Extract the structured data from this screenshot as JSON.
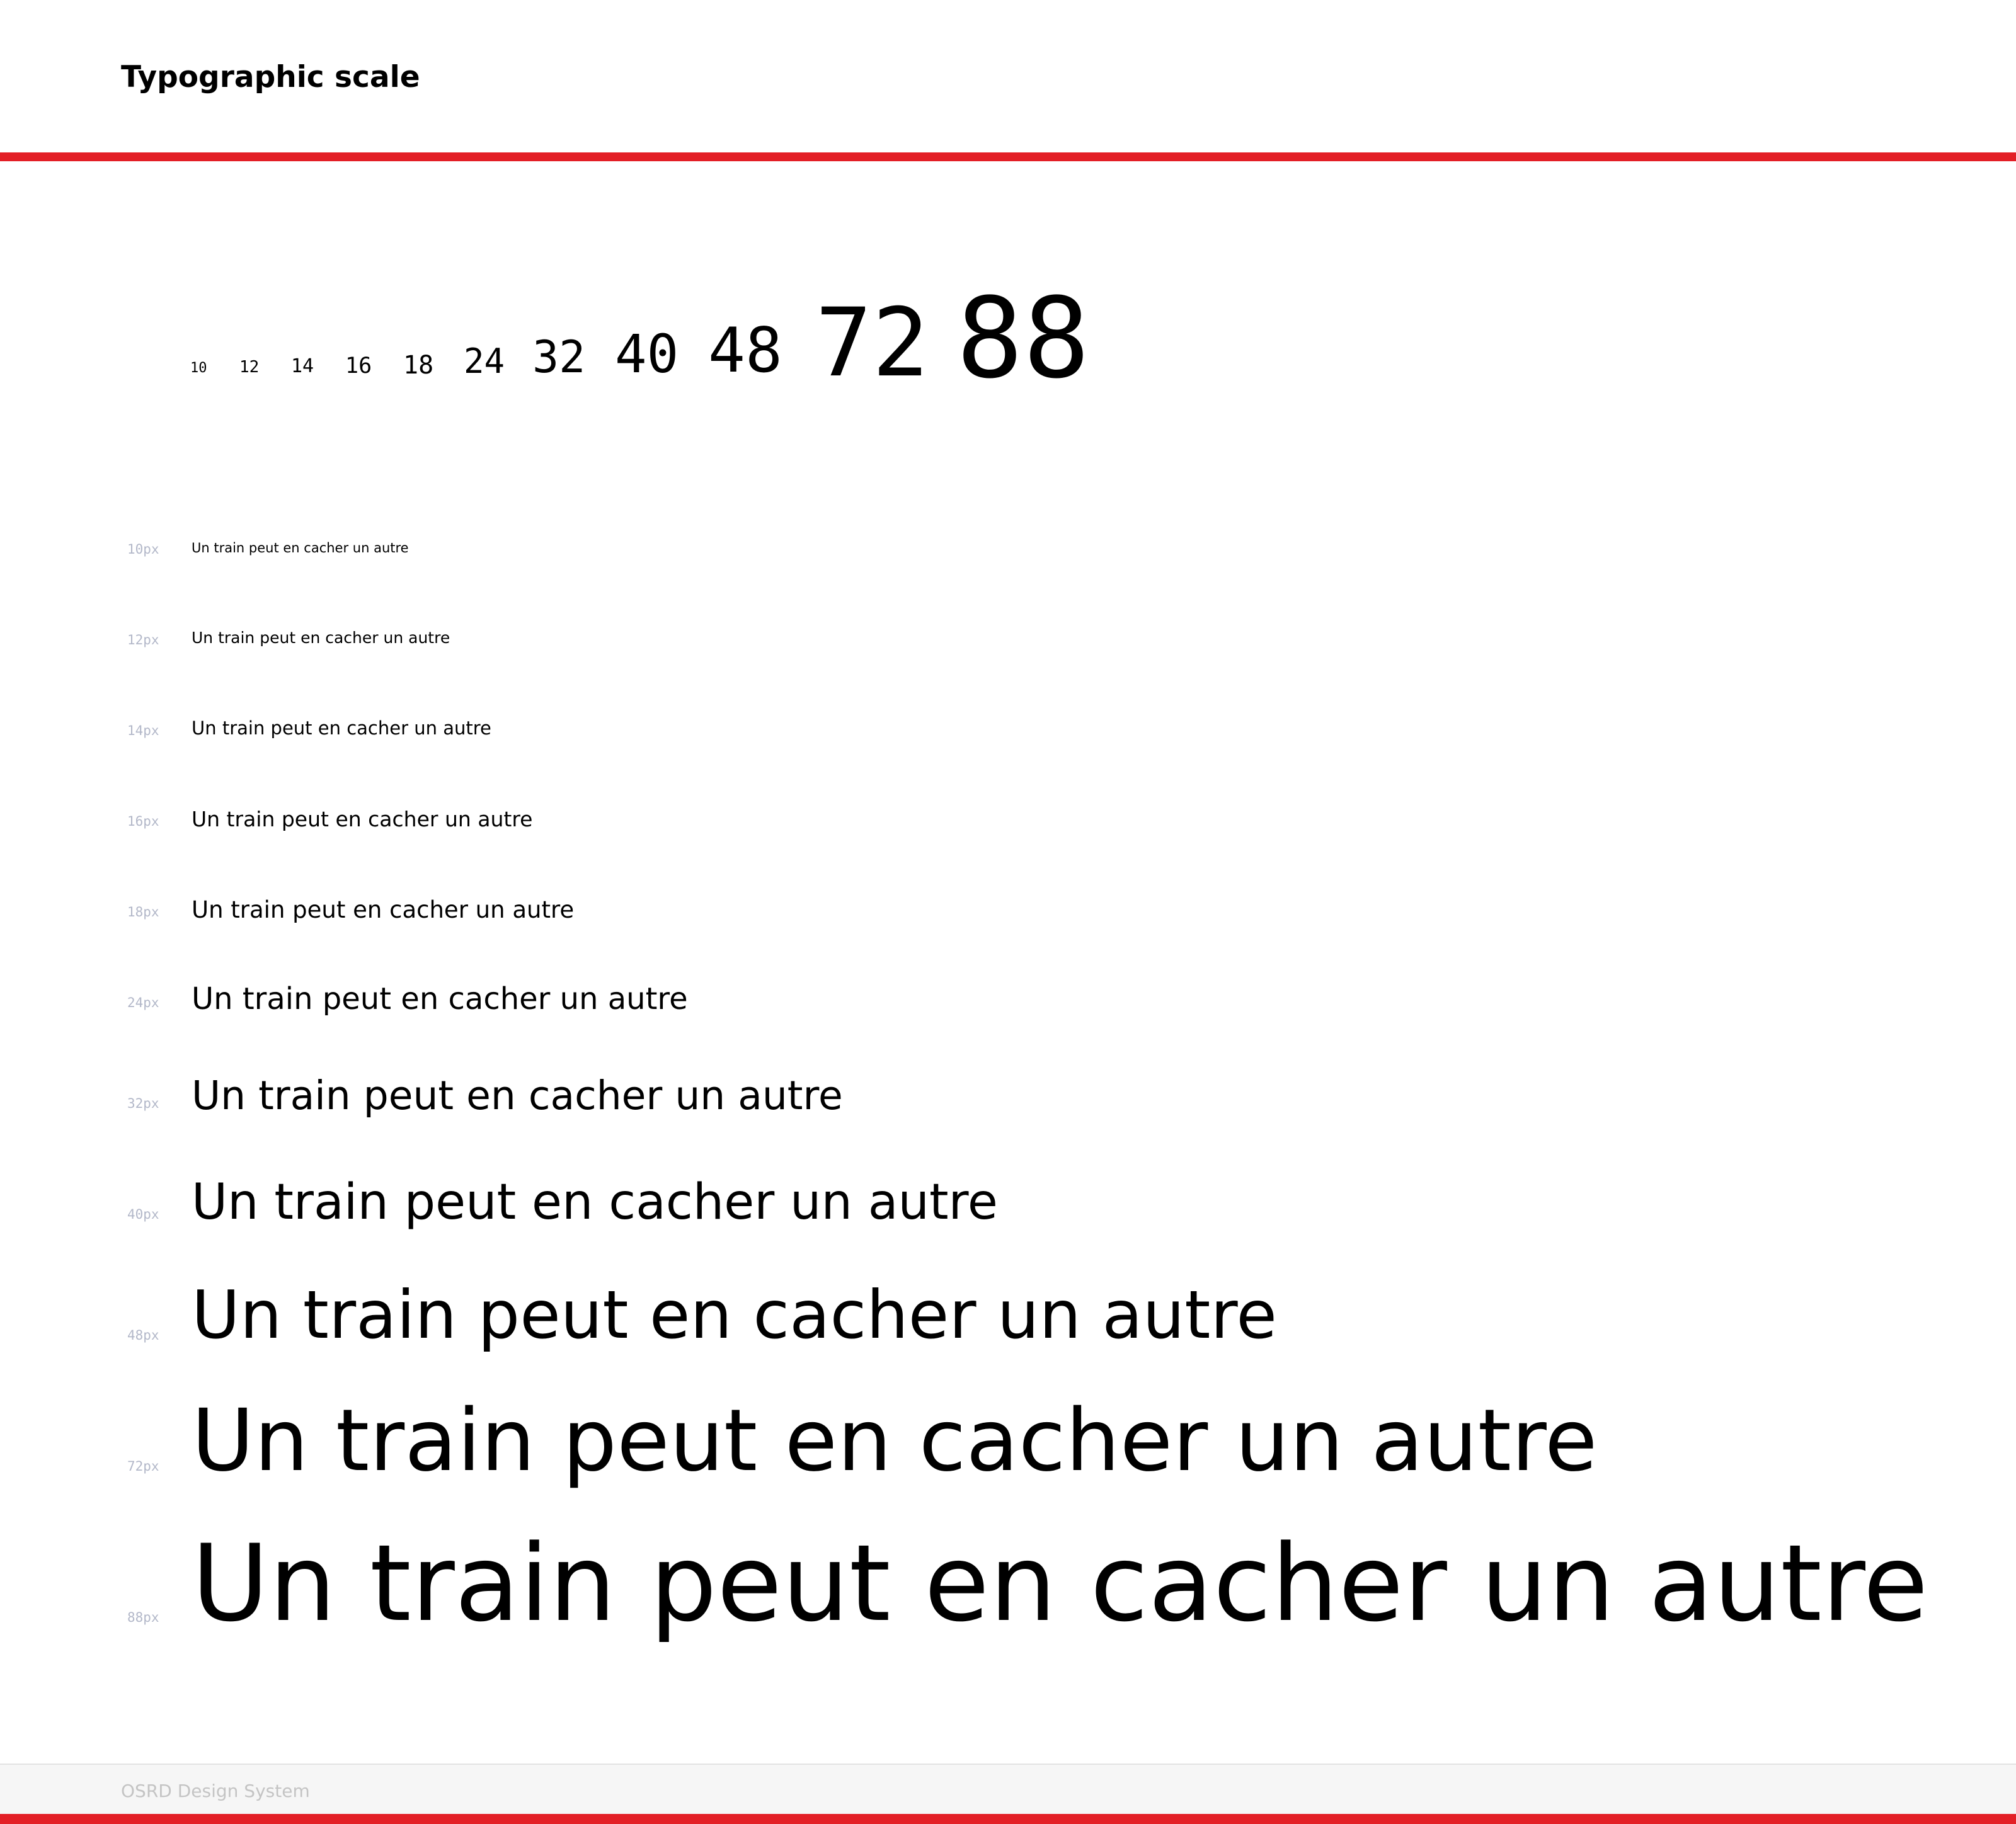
{
  "header": {
    "title": "Typographic scale"
  },
  "scale": {
    "sizes": [
      "10",
      "12",
      "14",
      "16",
      "18",
      "24",
      "32",
      "40",
      "48",
      "72",
      "88"
    ]
  },
  "samples": [
    {
      "label": "10px",
      "text": "Un train peut en cacher un autre"
    },
    {
      "label": "12px",
      "text": "Un train peut en cacher un autre"
    },
    {
      "label": "14px",
      "text": "Un train peut en cacher un autre"
    },
    {
      "label": "16px",
      "text": "Un train peut en cacher un autre"
    },
    {
      "label": "18px",
      "text": "Un train peut en cacher un autre"
    },
    {
      "label": "24px",
      "text": "Un train peut en cacher un autre"
    },
    {
      "label": "32px",
      "text": "Un train peut en cacher un autre"
    },
    {
      "label": "40px",
      "text": "Un train peut en cacher un autre"
    },
    {
      "label": "48px",
      "text": "Un train peut en cacher un autre"
    },
    {
      "label": "72px",
      "text": "Un train peut en cacher un autre"
    },
    {
      "label": "88px",
      "text": "Un train peut en cacher un autre"
    }
  ],
  "footer": {
    "text": "OSRD Design System"
  },
  "colors": {
    "accent": "#e31f26",
    "label": "#b3b8c9",
    "footer_bg": "#f6f6f6",
    "footer_text": "#c4c4c4"
  }
}
